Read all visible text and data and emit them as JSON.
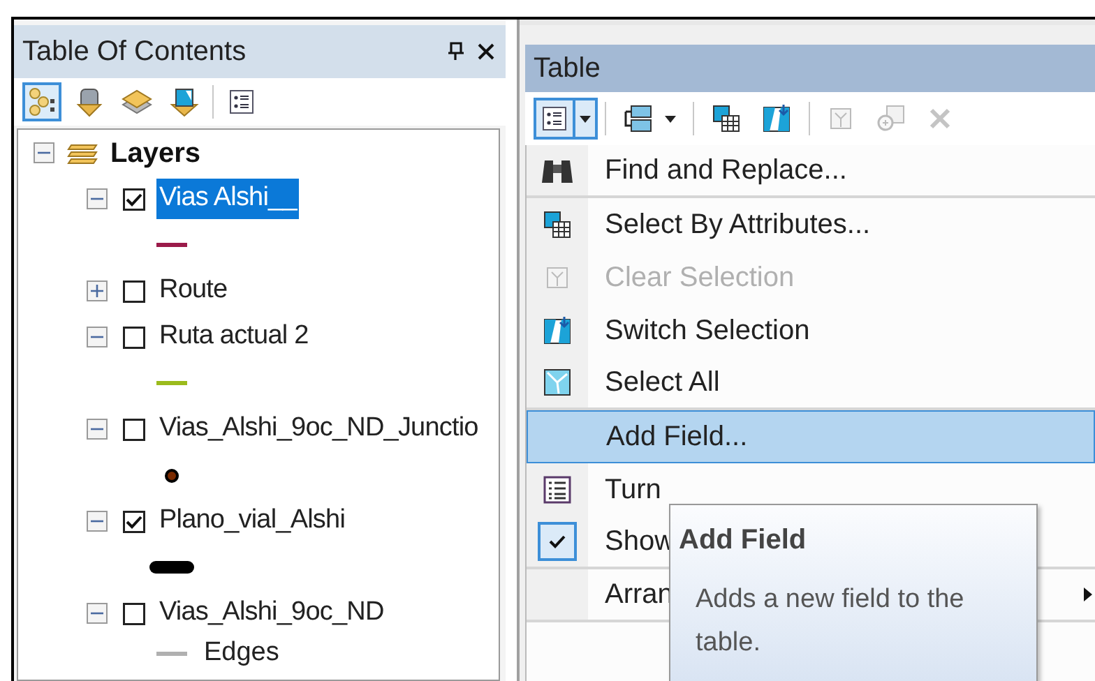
{
  "toc": {
    "title": "Table Of Contents",
    "tools": [
      {
        "kind": "drawing_order",
        "selected": true
      },
      {
        "kind": "source",
        "selected": false
      },
      {
        "kind": "visibility",
        "selected": false
      },
      {
        "kind": "selection",
        "selected": false
      },
      {
        "kind": "options",
        "selected": false
      }
    ],
    "root": {
      "label": "Layers",
      "expanded": true,
      "children": [
        {
          "label": "Vias Alshi__",
          "checked": true,
          "selected": true,
          "expanded": true,
          "legend": {
            "kind": "line",
            "color": "#9b1b4a"
          }
        },
        {
          "label": "Route",
          "checked": false,
          "selected": false,
          "expanded": false
        },
        {
          "label": "Ruta actual 2",
          "checked": false,
          "selected": false,
          "expanded": true,
          "legend": {
            "kind": "line",
            "color": "#9bbb1c"
          }
        },
        {
          "label": "Vias_Alshi_9oc_ND_Junctio",
          "checked": false,
          "selected": false,
          "expanded": true,
          "legend": {
            "kind": "point",
            "color": "#7a2a00"
          }
        },
        {
          "label": "Plano_vial_Alshi",
          "checked": true,
          "selected": false,
          "expanded": true,
          "legend": {
            "kind": "thick",
            "color": "#000000"
          }
        },
        {
          "label": "Vias_Alshi_9oc_ND",
          "checked": false,
          "selected": false,
          "expanded": true,
          "legend": {
            "kind": "line",
            "color": "#b0b0b0",
            "label": "Edges"
          }
        }
      ]
    }
  },
  "table": {
    "title": "Table",
    "tools": [
      {
        "kind": "options",
        "expanded": true,
        "disabled": false
      },
      {
        "kind": "related",
        "expanded": false,
        "disabled": false
      },
      {
        "kind": "select_by_attributes",
        "expanded": false,
        "disabled": false
      },
      {
        "kind": "switch",
        "expanded": false,
        "disabled": false
      },
      {
        "kind": "clear",
        "expanded": false,
        "disabled": true
      },
      {
        "kind": "zoom",
        "expanded": false,
        "disabled": true
      },
      {
        "kind": "delete",
        "expanded": false,
        "disabled": true
      }
    ],
    "menu": [
      {
        "label": "Find and Replace...",
        "kind": "binoculars",
        "disabled": false,
        "selected": false,
        "submenu": false,
        "separator_after": true
      },
      {
        "label": "Select By Attributes...",
        "kind": "select_by_attributes",
        "disabled": false,
        "selected": false,
        "submenu": false,
        "separator_after": false
      },
      {
        "label": "Clear Selection",
        "kind": "clear",
        "disabled": true,
        "selected": false,
        "submenu": false,
        "separator_after": false
      },
      {
        "label": "Switch Selection",
        "kind": "switch",
        "disabled": false,
        "selected": false,
        "submenu": false,
        "separator_after": false
      },
      {
        "label": "Select All",
        "kind": "select_all",
        "disabled": false,
        "selected": false,
        "submenu": false,
        "separator_after": true
      },
      {
        "label": "Add Field...",
        "kind": "plain",
        "disabled": false,
        "selected": true,
        "submenu": false,
        "separator_after": false
      },
      {
        "label": "Turn",
        "kind": "list",
        "disabled": false,
        "selected": false,
        "submenu": false,
        "separator_after": false
      },
      {
        "label": "Show",
        "kind": "check",
        "checked": true,
        "disabled": false,
        "selected": false,
        "submenu": false,
        "separator_after": true
      },
      {
        "label": "Arran",
        "kind": "plain",
        "disabled": false,
        "selected": false,
        "submenu": true,
        "separator_after": true
      }
    ],
    "tooltip": {
      "title": "Add Field",
      "text": "Adds a new field to the table."
    }
  }
}
